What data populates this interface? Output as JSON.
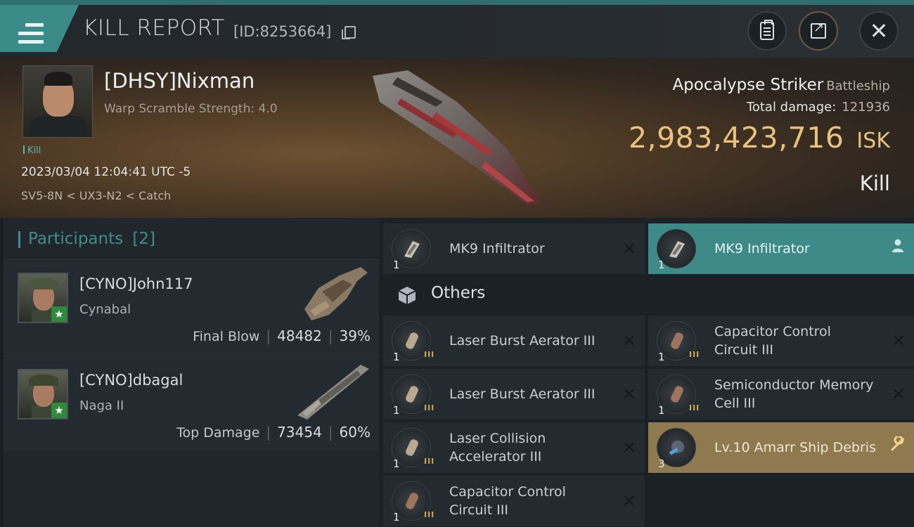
{
  "header": {
    "title": "KILL REPORT",
    "report_id": "[ID:8253664]",
    "buttons": [
      "clipboard-icon",
      "share-icon",
      "close-icon"
    ],
    "close_glyph": "✕"
  },
  "victim": {
    "name": "[DHSY]Nixman",
    "warp_scramble": "Warp Scramble Strength: 4.0",
    "tag": "Kill",
    "datetime": "2023/03/04 12:04:41 UTC -5",
    "location": "SV5-8N < UX3-N2 < Catch",
    "ship_name": "Apocalypse Striker",
    "ship_class": "Battleship",
    "total_damage_label": "Total damage:",
    "total_damage": "121936",
    "isk_value": "2,983,423,716",
    "isk_unit": "ISK",
    "result": "Kill"
  },
  "participants": {
    "header": "Participants",
    "count": "[2]",
    "list": [
      {
        "name": "[CYNO]John117",
        "ship": "Cynabal",
        "stat_label": "Final Blow",
        "damage": "48482",
        "percent": "39%"
      },
      {
        "name": "[CYNO]dbagal",
        "ship": "Naga II",
        "stat_label": "Top Damage",
        "damage": "73454",
        "percent": "60%"
      }
    ]
  },
  "items": {
    "top": [
      {
        "name": "MK9  Infiltrator",
        "qty": "1",
        "state": "normal",
        "action": "✕"
      },
      {
        "name": "MK9  Infiltrator",
        "qty": "1",
        "state": "selected",
        "action": "person-icon"
      }
    ],
    "others_label": "Others",
    "others": [
      {
        "name": "Laser Burst Aerator III",
        "qty": "1",
        "meta": "III",
        "action": "✕"
      },
      {
        "name": "Capacitor Control Circuit III",
        "qty": "1",
        "meta": "III",
        "action": "✕"
      },
      {
        "name": "Laser Burst Aerator III",
        "qty": "1",
        "meta": "III",
        "action": "✕"
      },
      {
        "name": "Semiconductor Memory Cell III",
        "qty": "1",
        "meta": "III",
        "action": "✕"
      },
      {
        "name": "Laser Collision Accelerator III",
        "qty": "1",
        "meta": "III",
        "action": "✕"
      },
      {
        "name": "Lv.10 Amarr Ship Debris",
        "qty": "3",
        "meta": "",
        "action": "wrench-icon",
        "state": "highlight"
      },
      {
        "name": "Capacitor Control Circuit III",
        "qty": "1",
        "meta": "III",
        "action": "✕"
      }
    ]
  },
  "colors": {
    "accent": "#3e8a88",
    "isk": "#e8c27e",
    "highlight": "#8f7a50"
  }
}
